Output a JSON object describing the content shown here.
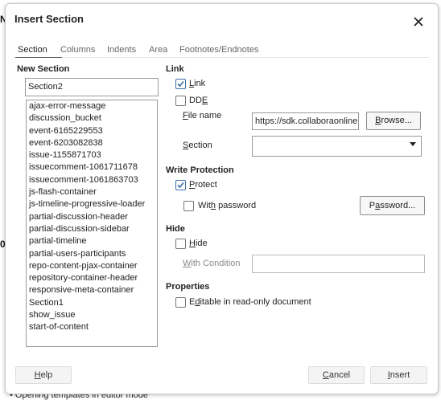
{
  "background": {
    "left_letter_top": "N",
    "left_letter_mid": "0",
    "bottom_text": "•   Opening templates in editor mode"
  },
  "dialog": {
    "title": "Insert Section",
    "close_icon": "close-icon",
    "tabs": [
      "Section",
      "Columns",
      "Indents",
      "Area",
      "Footnotes/Endnotes"
    ],
    "active_tab": "Section"
  },
  "new_section": {
    "heading": "New Section",
    "name_value": "Section2",
    "list": [
      "ajax-error-message",
      "discussion_bucket",
      "event-6165229553",
      "event-6203082838",
      "issue-1155871703",
      "issuecomment-1061711678",
      "issuecomment-1061863703",
      "js-flash-container",
      "js-timeline-progressive-loader",
      "partial-discussion-header",
      "partial-discussion-sidebar",
      "partial-timeline",
      "partial-users-participants",
      "repo-content-pjax-container",
      "repository-container-header",
      "responsive-meta-container",
      "Section1",
      "show_issue",
      "start-of-content"
    ]
  },
  "link": {
    "heading": "Link",
    "link_label": "Link",
    "link_checked": true,
    "dde_label": "DDE",
    "dde_checked": false,
    "file_name_label": "File name",
    "file_name_value": "https://sdk.collaboraonline",
    "browse_label": "Browse...",
    "section_label": "Section",
    "section_value": ""
  },
  "write_protection": {
    "heading": "Write Protection",
    "protect_label": "Protect",
    "protect_checked": true,
    "with_password_label": "With password",
    "with_password_checked": false,
    "password_button": "Password..."
  },
  "hide": {
    "heading": "Hide",
    "hide_label": "Hide",
    "hide_checked": false,
    "with_condition_label": "With Condition",
    "condition_value": ""
  },
  "properties": {
    "heading": "Properties",
    "editable_label": "Editable in read-only document",
    "editable_checked": false
  },
  "footer": {
    "help": "Help",
    "cancel": "Cancel",
    "insert": "Insert"
  },
  "colors": {
    "check_accent": "#3a6ea5",
    "border": "#999999"
  }
}
